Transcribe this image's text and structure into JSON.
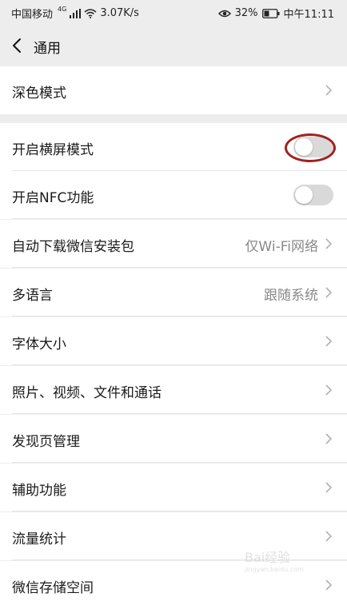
{
  "status_bar": {
    "carrier": "中国移动",
    "signal_label": "4G",
    "net_speed": "3.07K/s",
    "battery": "32%",
    "time": "中午11:11"
  },
  "nav": {
    "title": "通用"
  },
  "groups": {
    "dark_mode": {
      "label": "深色模式"
    },
    "landscape": {
      "label": "开启横屏模式",
      "toggle_on": false
    },
    "nfc": {
      "label": "开启NFC功能",
      "toggle_on": false
    },
    "auto_download": {
      "label": "自动下载微信安装包",
      "value": "仅Wi-Fi网络"
    },
    "language": {
      "label": "多语言",
      "value": "跟随系统"
    },
    "font_size": {
      "label": "字体大小"
    },
    "media": {
      "label": "照片、视频、文件和通话"
    },
    "discover": {
      "label": "发现页管理"
    },
    "assist": {
      "label": "辅助功能"
    },
    "traffic": {
      "label": "流量统计"
    },
    "storage": {
      "label": "微信存储空间"
    }
  },
  "colors": {
    "background": "#ededed",
    "row": "#ffffff",
    "toggle_off": "#d9d9d9",
    "highlight": "#a3201f"
  },
  "watermark": {
    "text": "Bai经验",
    "url": "jingyan.baidu.com"
  }
}
